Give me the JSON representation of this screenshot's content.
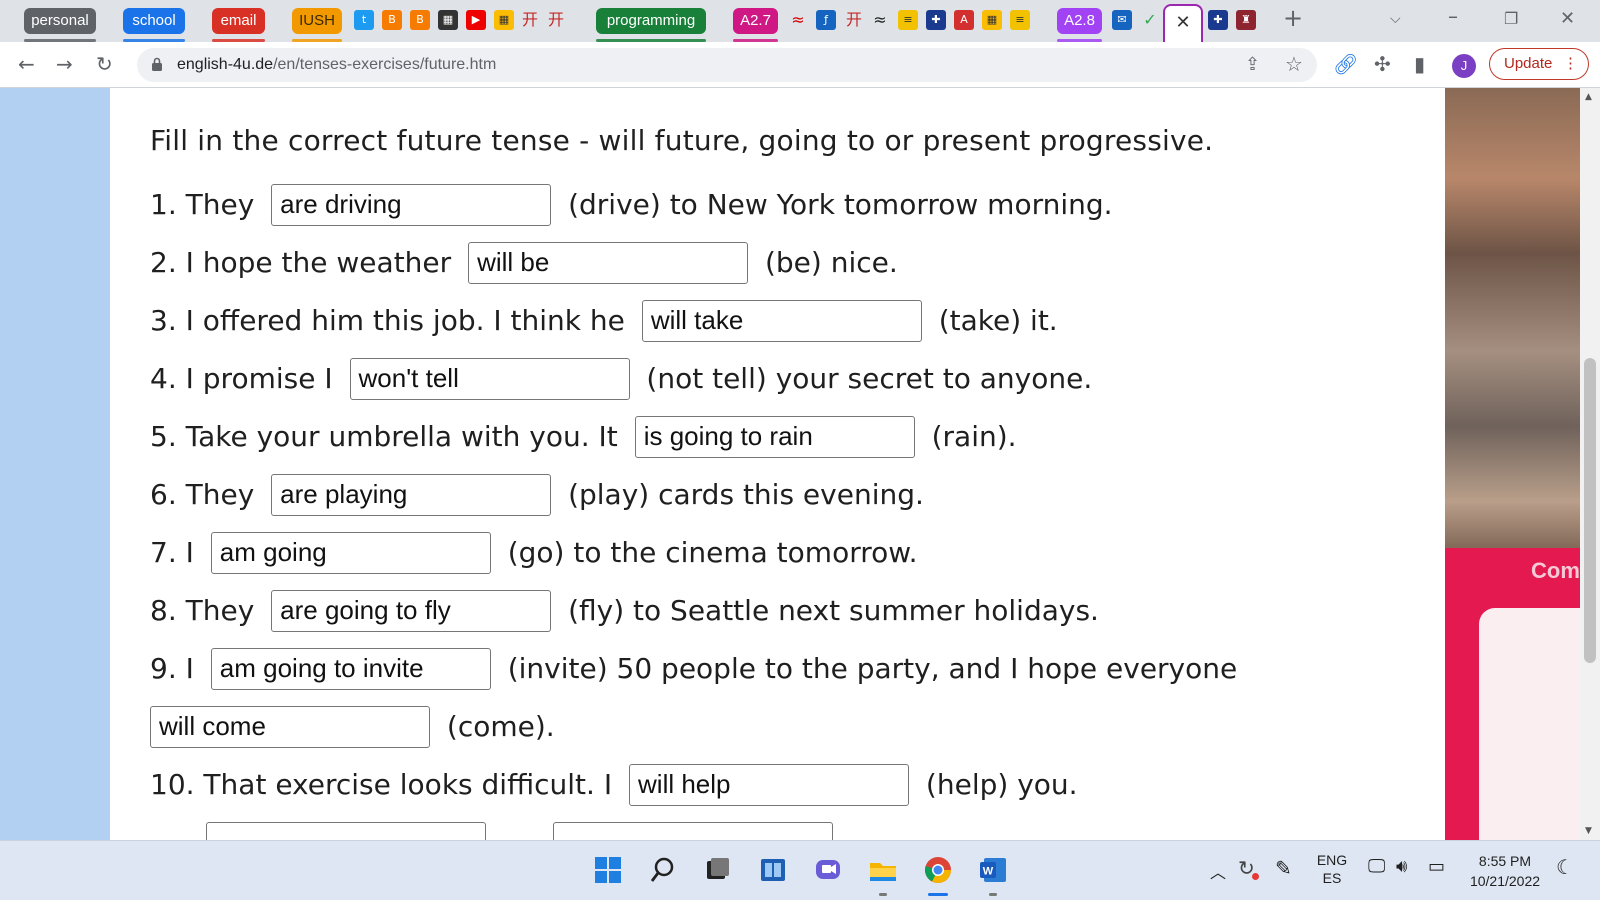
{
  "tabs": {
    "groups": [
      {
        "label": "personal",
        "color": "#5f6368"
      },
      {
        "label": "school",
        "color": "#1a73e8"
      },
      {
        "label": "email",
        "color": "#d93025"
      },
      {
        "label": "IUSH",
        "color": "#f29900"
      },
      {
        "label": "programming",
        "color": "#188038"
      },
      {
        "label": "A2.7",
        "color": "#d01884"
      },
      {
        "label": "A2.8",
        "color": "#a142f4"
      }
    ],
    "active_close": "✕",
    "new_tab": "+"
  },
  "toolbar": {
    "url_host": "english-4u.de",
    "url_path": "/en/tenses-exercises/future.htm",
    "update_label": "Update",
    "avatar_letter": "J"
  },
  "exercise": {
    "instruction": "Fill in the correct future tense - will future, going to or present progressive.",
    "items": [
      {
        "pre": "1. They",
        "answer": "are driving",
        "post": "(drive) to New York tomorrow morning."
      },
      {
        "pre": "2. I hope the weather",
        "answer": "will be",
        "post": "(be) nice."
      },
      {
        "pre": "3. I offered him this job. I think he",
        "answer": "will take",
        "post": "(take) it."
      },
      {
        "pre": "4. I promise I",
        "answer": "won't tell",
        "post": "(not tell) your secret to anyone."
      },
      {
        "pre": "5. Take your umbrella with you. It",
        "answer": "is going to rain",
        "post": "(rain)."
      },
      {
        "pre": "6. They",
        "answer": "are playing",
        "post": "(play) cards this evening."
      },
      {
        "pre": "7. I",
        "answer": "am going",
        "post": "(go) to the cinema tomorrow."
      },
      {
        "pre": "8. They",
        "answer": "are going to fly",
        "post": "(fly) to Seattle next summer holidays."
      },
      {
        "pre": "9. I",
        "answer": "am going to invite",
        "post": "(invite) 50 people to the party, and I hope everyone"
      },
      {
        "pre": "",
        "answer": "will come",
        "post": "(come)."
      },
      {
        "pre": "10. That exercise looks difficult. I",
        "answer": "will help",
        "post": "(help) you."
      }
    ]
  },
  "side_ad": {
    "text": "Com"
  },
  "taskbar": {
    "lang_top": "ENG",
    "lang_bottom": "ES",
    "time": "8:55 PM",
    "date": "10/21/2022"
  }
}
